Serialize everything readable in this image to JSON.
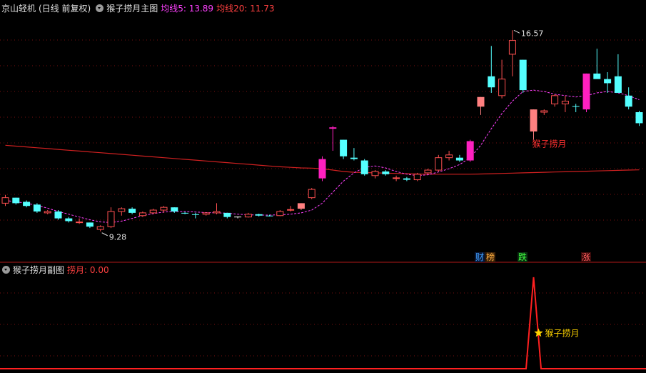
{
  "main_header": {
    "security": "京山轻机",
    "mode": "(日线 前复权)",
    "indicator": "猴子捞月主图",
    "ma5_label": "均线5: 13.89",
    "ma20_label": "均线20: 11.73"
  },
  "sub_header": {
    "indicator": "猴子捞月副图",
    "value_label": "捞月: 0.00"
  },
  "colors": {
    "up": "#ff5050",
    "down": "#54ffff",
    "magenta": "#ff20c0",
    "salmon": "#ff8080",
    "ma5": "#ff40ff",
    "ma20": "#d02020",
    "grid": "#7a1010",
    "gold": "#ffd400",
    "white": "#ffffff"
  },
  "badges": [
    {
      "text": "财",
      "color": "#40a0ff",
      "bg": "#0a1a3a"
    },
    {
      "text": "榜",
      "color": "#ffb040",
      "bg": "#3a2008"
    },
    {
      "text": "跌",
      "color": "#40ff40",
      "bg": "#0a3010"
    },
    {
      "text": "涨",
      "color": "#ff6060",
      "bg": "#3a0a0a"
    }
  ],
  "chart_data": [
    {
      "type": "candlestick",
      "title": "猴子捞月主图",
      "high_marker": "16.57",
      "low_marker": "9.28",
      "signal_label": "猴子捞月",
      "ylim": [
        8.6,
        17.2
      ],
      "candles": [
        {
          "o": 10.3,
          "h": 10.6,
          "l": 10.2,
          "c": 10.5,
          "s": "up"
        },
        {
          "o": 10.5,
          "h": 10.5,
          "l": 10.25,
          "c": 10.3,
          "s": "down"
        },
        {
          "o": 10.35,
          "h": 10.4,
          "l": 10.15,
          "c": 10.2,
          "s": "down"
        },
        {
          "o": 10.25,
          "h": 10.3,
          "l": 9.95,
          "c": 10.0,
          "s": "down"
        },
        {
          "o": 10.0,
          "h": 10.05,
          "l": 9.9,
          "c": 9.95,
          "s": "up"
        },
        {
          "o": 10.0,
          "h": 10.05,
          "l": 9.7,
          "c": 9.75,
          "s": "down"
        },
        {
          "o": 9.75,
          "h": 9.8,
          "l": 9.6,
          "c": 9.65,
          "s": "down"
        },
        {
          "o": 9.6,
          "h": 9.75,
          "l": 9.55,
          "c": 9.62,
          "s": "up"
        },
        {
          "o": 9.6,
          "h": 9.6,
          "l": 9.4,
          "c": 9.45,
          "s": "down"
        },
        {
          "o": 9.45,
          "h": 9.5,
          "l": 9.28,
          "c": 9.35,
          "s": "up"
        },
        {
          "o": 9.45,
          "h": 10.15,
          "l": 9.4,
          "c": 10.0,
          "s": "up"
        },
        {
          "o": 10.0,
          "h": 10.15,
          "l": 9.85,
          "c": 10.1,
          "s": "up"
        },
        {
          "o": 10.1,
          "h": 10.15,
          "l": 9.9,
          "c": 9.95,
          "s": "down"
        },
        {
          "o": 9.85,
          "h": 10.0,
          "l": 9.8,
          "c": 9.95,
          "s": "up"
        },
        {
          "o": 9.95,
          "h": 10.1,
          "l": 9.9,
          "c": 10.05,
          "s": "up"
        },
        {
          "o": 10.05,
          "h": 10.2,
          "l": 9.95,
          "c": 10.15,
          "s": "up"
        },
        {
          "o": 10.15,
          "h": 10.15,
          "l": 9.95,
          "c": 10.0,
          "s": "down"
        },
        {
          "o": 9.95,
          "h": 9.98,
          "l": 9.9,
          "c": 9.93,
          "s": "down"
        },
        {
          "o": 9.9,
          "h": 9.95,
          "l": 9.75,
          "c": 9.9,
          "s": "down"
        },
        {
          "o": 9.9,
          "h": 9.95,
          "l": 9.85,
          "c": 9.95,
          "s": "up"
        },
        {
          "o": 9.95,
          "h": 10.3,
          "l": 9.9,
          "c": 10.0,
          "s": "up"
        },
        {
          "o": 9.95,
          "h": 9.95,
          "l": 9.75,
          "c": 9.8,
          "s": "down"
        },
        {
          "o": 9.8,
          "h": 9.82,
          "l": 9.75,
          "c": 9.79,
          "s": "white"
        },
        {
          "o": 9.8,
          "h": 9.95,
          "l": 9.78,
          "c": 9.9,
          "s": "up"
        },
        {
          "o": 9.9,
          "h": 9.92,
          "l": 9.82,
          "c": 9.85,
          "s": "down"
        },
        {
          "o": 9.85,
          "h": 9.88,
          "l": 9.82,
          "c": 9.84,
          "s": "down"
        },
        {
          "o": 9.85,
          "h": 10.05,
          "l": 9.83,
          "c": 10.0,
          "s": "up"
        },
        {
          "o": 10.05,
          "h": 10.2,
          "l": 10.0,
          "c": 10.07,
          "s": "up"
        },
        {
          "o": 10.1,
          "h": 10.3,
          "l": 10.05,
          "c": 10.3,
          "s": "salmon"
        },
        {
          "o": 10.5,
          "h": 10.85,
          "l": 10.45,
          "c": 10.8,
          "s": "up"
        },
        {
          "o": 11.2,
          "h": 12.0,
          "l": 11.1,
          "c": 11.9,
          "s": "magenta"
        },
        {
          "o": 13.0,
          "h": 13.1,
          "l": 12.2,
          "c": 13.05,
          "s": "magenta"
        },
        {
          "o": 12.6,
          "h": 12.6,
          "l": 11.9,
          "c": 12.0,
          "s": "down"
        },
        {
          "o": 11.95,
          "h": 12.3,
          "l": 11.85,
          "c": 11.9,
          "s": "down"
        },
        {
          "o": 11.85,
          "h": 11.9,
          "l": 11.3,
          "c": 11.35,
          "s": "down"
        },
        {
          "o": 11.3,
          "h": 11.5,
          "l": 11.2,
          "c": 11.45,
          "s": "up"
        },
        {
          "o": 11.45,
          "h": 11.5,
          "l": 11.3,
          "c": 11.35,
          "s": "down"
        },
        {
          "o": 11.22,
          "h": 11.3,
          "l": 11.1,
          "c": 11.22,
          "s": "up"
        },
        {
          "o": 11.15,
          "h": 11.25,
          "l": 11.1,
          "c": 11.2,
          "s": "down"
        },
        {
          "o": 11.15,
          "h": 11.4,
          "l": 11.1,
          "c": 11.35,
          "s": "up"
        },
        {
          "o": 11.4,
          "h": 11.55,
          "l": 11.35,
          "c": 11.5,
          "s": "up"
        },
        {
          "o": 11.5,
          "h": 12.05,
          "l": 11.45,
          "c": 11.95,
          "s": "up"
        },
        {
          "o": 11.95,
          "h": 12.2,
          "l": 11.85,
          "c": 12.05,
          "s": "up"
        },
        {
          "o": 11.95,
          "h": 12.05,
          "l": 11.8,
          "c": 11.85,
          "s": "down"
        },
        {
          "o": 11.85,
          "h": 12.6,
          "l": 11.8,
          "c": 12.55,
          "s": "magenta"
        },
        {
          "o": 13.8,
          "h": 14.15,
          "l": 13.5,
          "c": 14.15,
          "s": "salmon"
        },
        {
          "o": 14.9,
          "h": 16.0,
          "l": 14.3,
          "c": 14.5,
          "s": "down"
        },
        {
          "o": 14.2,
          "h": 15.5,
          "l": 14.1,
          "c": 14.8,
          "s": "up"
        },
        {
          "o": 15.7,
          "h": 16.57,
          "l": 14.9,
          "c": 16.2,
          "s": "up"
        },
        {
          "o": 15.5,
          "h": 15.5,
          "l": 14.3,
          "c": 14.4,
          "s": "down"
        },
        {
          "o": 13.7,
          "h": 13.7,
          "l": 12.6,
          "c": 12.9,
          "s": "salmon"
        },
        {
          "o": 13.6,
          "h": 13.7,
          "l": 13.5,
          "c": 13.65,
          "s": "up"
        },
        {
          "o": 13.9,
          "h": 14.25,
          "l": 13.8,
          "c": 14.2,
          "s": "up"
        },
        {
          "o": 13.9,
          "h": 14.2,
          "l": 13.6,
          "c": 14.0,
          "s": "up"
        },
        {
          "o": 13.82,
          "h": 13.9,
          "l": 13.6,
          "c": 13.82,
          "s": "down"
        },
        {
          "o": 13.7,
          "h": 15.0,
          "l": 13.6,
          "c": 15.0,
          "s": "magenta"
        },
        {
          "o": 15.0,
          "h": 15.9,
          "l": 14.9,
          "c": 14.8,
          "s": "down"
        },
        {
          "o": 14.8,
          "h": 15.05,
          "l": 14.3,
          "c": 14.65,
          "s": "down"
        },
        {
          "o": 14.9,
          "h": 15.7,
          "l": 14.4,
          "c": 14.3,
          "s": "down"
        },
        {
          "o": 14.2,
          "h": 14.5,
          "l": 13.7,
          "c": 13.8,
          "s": "down"
        },
        {
          "o": 13.6,
          "h": 13.65,
          "l": 13.1,
          "c": 13.2,
          "s": "down"
        }
      ],
      "ma5": [
        10.4,
        10.35,
        10.3,
        10.22,
        10.12,
        10.0,
        9.9,
        9.8,
        9.7,
        9.62,
        9.6,
        9.65,
        9.75,
        9.85,
        9.92,
        9.98,
        10.0,
        10.0,
        9.98,
        9.96,
        9.95,
        9.94,
        9.9,
        9.88,
        9.87,
        9.87,
        9.88,
        9.9,
        9.95,
        10.05,
        10.3,
        10.7,
        11.1,
        11.4,
        11.6,
        11.65,
        11.58,
        11.45,
        11.35,
        11.3,
        11.33,
        11.43,
        11.55,
        11.7,
        11.95,
        12.4,
        13.0,
        13.55,
        14.0,
        14.35,
        14.4,
        14.35,
        14.25,
        14.2,
        14.15,
        14.2,
        14.3,
        14.35,
        14.3,
        14.2,
        14.05
      ],
      "ma20": [
        12.4,
        12.37,
        12.34,
        12.31,
        12.28,
        12.25,
        12.22,
        12.19,
        12.16,
        12.13,
        12.1,
        12.07,
        12.04,
        12.01,
        11.98,
        11.95,
        11.92,
        11.89,
        11.86,
        11.83,
        11.8,
        11.77,
        11.74,
        11.71,
        11.68,
        11.65,
        11.62,
        11.6,
        11.58,
        11.57,
        11.55,
        11.5,
        11.45,
        11.42,
        11.41,
        11.4,
        11.39,
        11.38,
        11.37,
        11.36,
        11.35,
        11.35,
        11.35,
        11.35,
        11.35,
        11.36,
        11.37,
        11.38,
        11.39,
        11.4,
        11.41,
        11.42,
        11.43,
        11.44,
        11.45,
        11.46,
        11.47,
        11.48,
        11.49,
        11.5,
        11.51
      ]
    },
    {
      "type": "line",
      "title": "猴子捞月副图",
      "series_name": "捞月",
      "annotation": "猴子捞月",
      "ylim": [
        0,
        1
      ],
      "values": [
        0,
        0,
        0,
        0,
        0,
        0,
        0,
        0,
        0,
        0,
        0,
        0,
        0,
        0,
        0,
        0,
        0,
        0,
        0,
        0,
        0,
        0,
        0,
        0,
        0,
        0,
        0,
        0,
        0,
        0,
        0,
        0,
        0,
        0,
        0,
        0,
        0,
        0,
        0,
        0,
        0,
        0,
        0,
        0,
        0,
        0,
        0,
        0,
        0,
        0,
        1,
        0,
        0,
        0,
        0,
        0,
        0,
        0,
        0,
        0,
        0
      ]
    }
  ]
}
